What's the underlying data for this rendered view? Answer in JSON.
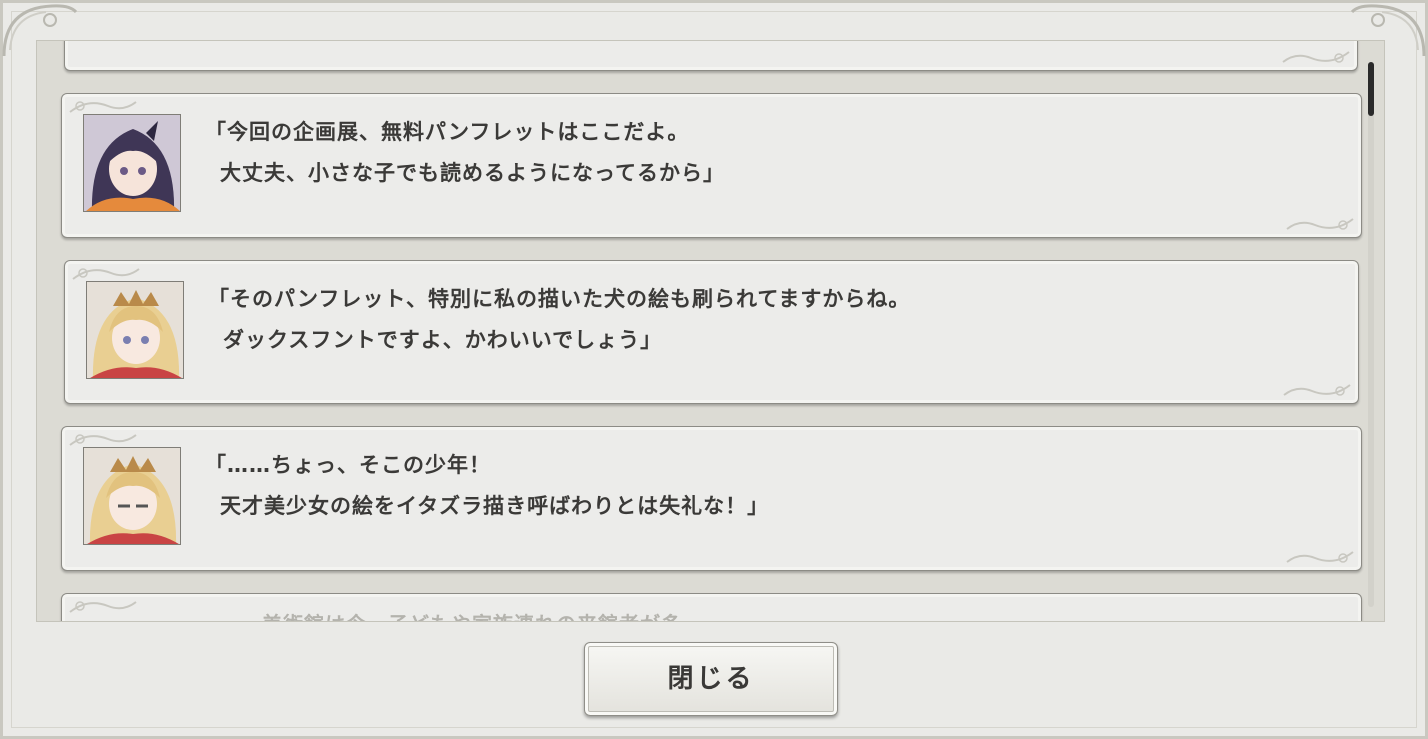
{
  "log": {
    "entries": [
      {
        "speaker_icon": "character-portrait-purple-hair",
        "line1": "「今回の企画展、無料パンフレットはここだよ。",
        "line2": "大丈夫、小さな子でも読めるようになってるから」"
      },
      {
        "speaker_icon": "character-portrait-blonde-hair",
        "line1": "「そのパンフレット、特別に私の描いた犬の絵も刷られてますからね。",
        "line2": "ダックスフントですよ、かわいいでしょう」"
      },
      {
        "speaker_icon": "character-portrait-blonde-hair",
        "line1": "「……ちょっ、そこの少年！",
        "line2": "天才美少女の絵をイタズラ描き呼ばわりとは失礼な！」"
      }
    ],
    "faded_bottom_text": "美術館は今、子どもや家族連れの来館者が多"
  },
  "buttons": {
    "close_label": "閉じる"
  },
  "colors": {
    "panel_background": "#ececea",
    "text": "#3b3a38",
    "scroll_thumb": "#2a2a2a"
  }
}
